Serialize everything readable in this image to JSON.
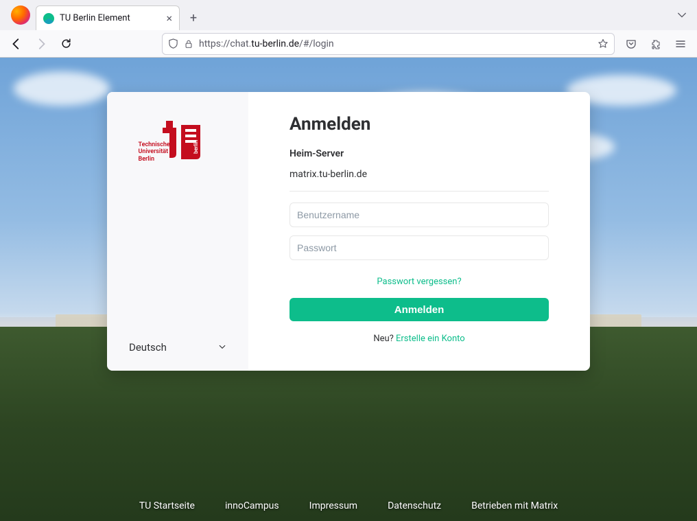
{
  "browser": {
    "tab_title": "TU Berlin Element",
    "url_prefix": "https://chat.",
    "url_host": "tu-berlin.de",
    "url_suffix": "/#/login"
  },
  "logo": {
    "line1": "Technische",
    "line2": "Universität",
    "line3": "Berlin"
  },
  "language": "Deutsch",
  "login": {
    "heading": "Anmelden",
    "homeserver_label": "Heim-Server",
    "homeserver_value": "matrix.tu-berlin.de",
    "username_placeholder": "Benutzername",
    "password_placeholder": "Passwort",
    "forgot": "Passwort vergessen?",
    "submit": "Anmelden",
    "new_prefix": "Neu? ",
    "create_account": "Erstelle ein Konto"
  },
  "footer": {
    "links": [
      "TU Startseite",
      "innoCampus",
      "Impressum",
      "Datenschutz",
      "Betrieben mit Matrix"
    ]
  }
}
